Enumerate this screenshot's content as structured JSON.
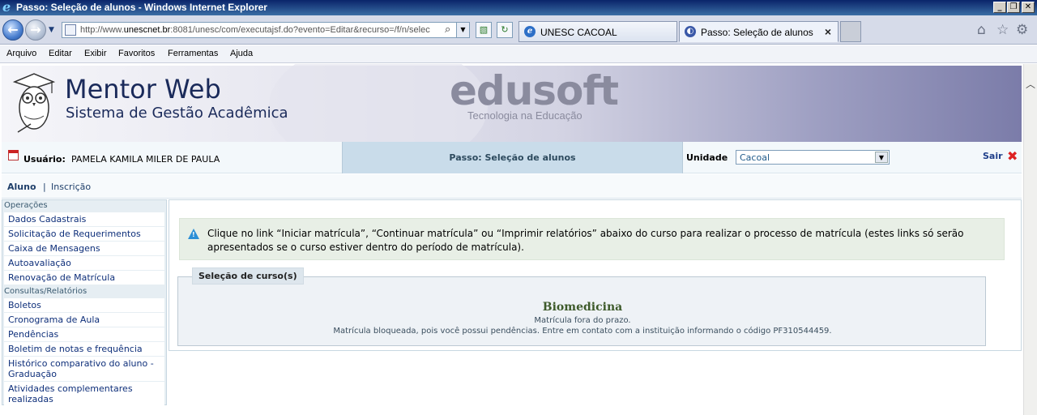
{
  "window": {
    "title": "Passo: Seleção de alunos - Windows Internet Explorer"
  },
  "nav": {
    "url_prefix": "http://www.",
    "url_host": "unescnet.br",
    "url_rest": ":8081/unesc/com/executajsf.do?evento=Editar&recurso=/f/n/selec"
  },
  "tabs": [
    {
      "label": "UNESC CACOAL"
    },
    {
      "label": "Passo: Seleção de alunos"
    }
  ],
  "menu": [
    "Arquivo",
    "Editar",
    "Exibir",
    "Favoritos",
    "Ferramentas",
    "Ajuda"
  ],
  "banner": {
    "title": "Mentor Web",
    "subtitle": "Sistema de Gestão Acadêmica",
    "brand": "edusoft",
    "brand_tag": "Tecnologia na Educação"
  },
  "userbar": {
    "user_label": "Usuário:",
    "user_name": "PAMELA KAMILA MILER DE PAULA",
    "step": "Passo: Seleção de alunos",
    "unit_label": "Unidade",
    "unit_value": "Cacoal",
    "logout": "Sair"
  },
  "subnav": {
    "aluno": "Aluno",
    "sep": "|",
    "inscricao": "Inscrição"
  },
  "sidebar": {
    "sections": [
      {
        "title": "Operações",
        "items": [
          "Dados Cadastrais",
          "Solicitação de Requerimentos",
          "Caixa de Mensagens",
          "Autoavaliação",
          "Renovação de Matrícula"
        ]
      },
      {
        "title": "Consultas/Relatórios",
        "items": [
          "Boletos",
          "Cronograma de Aula",
          "Pendências",
          "Boletim de notas e frequência",
          "Histórico comparativo do aluno - Graduação",
          "Atividades complementares realizadas"
        ]
      }
    ]
  },
  "content": {
    "info": "Clique no link “Iniciar matrícula”, “Continuar matrícula” ou “Imprimir relatórios” abaixo do curso para realizar o processo de matrícula (estes links só serão apresentados se o curso estiver dentro do período de matrícula).",
    "legend": "Seleção de curso(s)",
    "course": "Biomedicina",
    "line1": "Matrícula fora do prazo.",
    "line2": "Matrícula bloqueada, pois você possui pendências. Entre em contato com a instituição informando o código PF310544459."
  }
}
